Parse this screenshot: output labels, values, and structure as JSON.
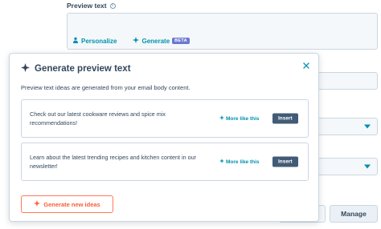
{
  "field": {
    "label": "Preview text",
    "info_icon": "info-icon"
  },
  "toolbar": {
    "personalize_label": "Personalize",
    "personalize_icon": "person-icon",
    "generate_label": "Generate",
    "generate_icon": "sparkle-icon",
    "beta_badge": "BETA"
  },
  "modal": {
    "title": "Generate preview text",
    "title_icon": "sparkle-icon",
    "close_icon": "close-icon",
    "description": "Preview text ideas are generated from your email body content.",
    "ideas": [
      {
        "text": "Check out our latest cookware reviews and spice mix recommendations!",
        "more_like_label": "More like this",
        "insert_label": "Insert"
      },
      {
        "text": "Learn about the latest trending recipes and kitchen content in our newsletter!",
        "more_like_label": "More like this",
        "insert_label": "Insert"
      }
    ],
    "generate_new_label": "Generate new ideas"
  },
  "background": {
    "manage_label": "Manage"
  },
  "colors": {
    "link": "#0091ae",
    "primary_text": "#33475b",
    "accent_orange": "#ff7a59",
    "insert_button": "#425b76",
    "beta_badge": "#6a78d1"
  }
}
